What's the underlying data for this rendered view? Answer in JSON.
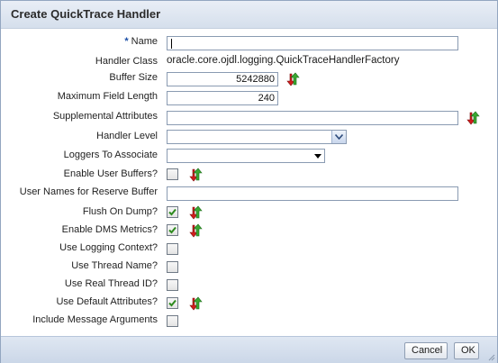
{
  "dialog": {
    "title": "Create QuickTrace Handler"
  },
  "form": {
    "required_marker": "*",
    "name": {
      "label": "Name",
      "value": ""
    },
    "handler_class": {
      "label": "Handler Class",
      "value": "oracle.core.ojdl.logging.QuickTraceHandlerFactory"
    },
    "buffer_size": {
      "label": "Buffer Size",
      "value": "5242880"
    },
    "max_field_length": {
      "label": "Maximum Field Length",
      "value": "240"
    },
    "supplemental_attributes": {
      "label": "Supplemental Attributes",
      "value": ""
    },
    "handler_level": {
      "label": "Handler Level",
      "value": ""
    },
    "loggers_to_associate": {
      "label": "Loggers To Associate",
      "value": ""
    },
    "enable_user_buffers": {
      "label": "Enable User Buffers?",
      "checked": false
    },
    "user_names_reserve_buffer": {
      "label": "User Names for Reserve Buffer",
      "value": ""
    },
    "flush_on_dump": {
      "label": "Flush On Dump?",
      "checked": true
    },
    "enable_dms_metrics": {
      "label": "Enable DMS Metrics?",
      "checked": true
    },
    "use_logging_context": {
      "label": "Use Logging Context?",
      "checked": false
    },
    "use_thread_name": {
      "label": "Use Thread Name?",
      "checked": false
    },
    "use_real_thread_id": {
      "label": "Use Real Thread ID?",
      "checked": false
    },
    "use_default_attributes": {
      "label": "Use Default Attributes?",
      "checked": true
    },
    "include_message_arguments": {
      "label": "Include Message Arguments",
      "checked": false
    }
  },
  "buttons": {
    "cancel": "Cancel",
    "ok": "OK"
  },
  "icons": {
    "reset": "reset-to-default-icon",
    "check": "checkmark-icon",
    "dropdown": "chevron-down-icon",
    "resize": "resize-grip-icon"
  },
  "colors": {
    "titlebar": "#dfe6f1",
    "check_green": "#2e8b1e",
    "reset_red": "#d21c1c",
    "reset_green": "#2f9a2a"
  }
}
